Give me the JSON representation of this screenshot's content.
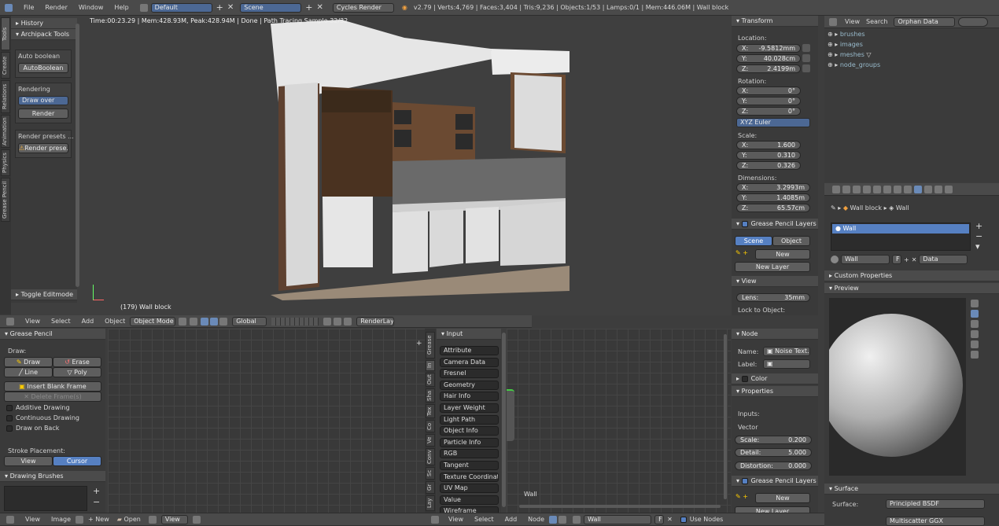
{
  "topbar": {
    "menus": [
      "File",
      "Render",
      "Window",
      "Help"
    ],
    "screen": "Default",
    "scene": "Scene",
    "engine": "Cycles Render",
    "stats": "v2.79 | Verts:4,769 | Faces:3,404 | Tris:9,236 | Objects:1/53 | Lamps:0/1 | Mem:446.06M | Wall block"
  },
  "viewport": {
    "render_info": "Time:00:23.29 | Mem:428.93M, Peak:428.94M | Done | Path Tracing Sample 32/32",
    "object_label": "(179) Wall block"
  },
  "vtabs": [
    "Tools",
    "Create",
    "Relations",
    "Animation",
    "Physics",
    "Grease Pencil"
  ],
  "tools": {
    "history": "History",
    "archipack": "Archipack Tools",
    "auto_boolean": "Auto boolean",
    "autoboolean_btn": "AutoBoolean",
    "rendering": "Rendering",
    "draw_over": "Draw over",
    "render_btn": "Render",
    "presets": "Render presets ...",
    "presets_btn": "Render prese...",
    "toggle_edit": "Toggle Editmode"
  },
  "transform": {
    "title": "Transform",
    "location": "Location:",
    "loc": [
      [
        "X:",
        "-9.5812mm"
      ],
      [
        "Y:",
        "40.028cm"
      ],
      [
        "Z:",
        "2.4199m"
      ]
    ],
    "rotation": "Rotation:",
    "rot": [
      [
        "X:",
        "0°"
      ],
      [
        "Y:",
        "0°"
      ],
      [
        "Z:",
        "0°"
      ]
    ],
    "euler": "XYZ Euler",
    "scale": "Scale:",
    "scl": [
      [
        "X:",
        "1.600"
      ],
      [
        "Y:",
        "0.310"
      ],
      [
        "Z:",
        "0.326"
      ]
    ],
    "dimensions": "Dimensions:",
    "dim": [
      [
        "X:",
        "3.2993m"
      ],
      [
        "Y:",
        "1.4085m"
      ],
      [
        "Z:",
        "65.57cm"
      ]
    ],
    "gp_layers": "Grease Pencil Layers",
    "scene": "Scene",
    "object": "Object",
    "new": "New",
    "new_layer": "New Layer",
    "view": "View",
    "lens_label": "Lens:",
    "lens_val": "35mm",
    "lock": "Lock to Object:"
  },
  "outliner": {
    "view": "View",
    "search": "Search",
    "mode": "Orphan Data",
    "items": [
      "brushes",
      "images",
      "meshes",
      "node_groups"
    ]
  },
  "properties": {
    "path1": "Wall block",
    "path2": "Wall",
    "slot": "Wall",
    "mat_name": "Wall",
    "data": "Data",
    "custom": "Custom Properties",
    "preview": "Preview",
    "surface": "Surface",
    "surface_label": "Surface:",
    "surface_val": "Principled BSDF",
    "dist": "Multiscatter GGX"
  },
  "v3dheader": {
    "items": [
      "View",
      "Select",
      "Add",
      "Object"
    ],
    "mode": "Object Mode",
    "orient": "Global",
    "layer": "RenderLayer"
  },
  "gpencil": {
    "title": "Grease Pencil",
    "draw": "Draw:",
    "draw_btn": "Draw",
    "erase": "Erase",
    "line": "Line",
    "poly": "Poly",
    "insert": "Insert Blank Frame",
    "delete": "Delete Frame(s)",
    "additive": "Additive Drawing",
    "continuous": "Continuous Drawing",
    "back": "Draw on Back",
    "stroke": "Stroke Placement:",
    "view": "View",
    "cursor": "Cursor",
    "brushes": "Drawing Brushes"
  },
  "nodes": {
    "input": "Input",
    "list": [
      "Attribute",
      "Camera Data",
      "Fresnel",
      "Geometry",
      "Hair Info",
      "Layer Weight",
      "Light Path",
      "Object Info",
      "Particle Info",
      "RGB",
      "Tangent",
      "Texture Coordinate",
      "UV Map",
      "Value",
      "Wireframe"
    ],
    "tabs": [
      "Grease",
      "In",
      "Out",
      "Sha",
      "Tex",
      "Co",
      "Ve",
      "Conv",
      "Sc",
      "Gr",
      "Lay"
    ],
    "canvas_label": "Wall"
  },
  "nodeprops": {
    "title": "Node",
    "name": "Name:",
    "name_val": "Noise Text...",
    "label": "Label:",
    "color": "Color",
    "properties": "Properties",
    "inputs": "Inputs:",
    "vector": "Vector",
    "scale": [
      "Scale:",
      "0.200"
    ],
    "detail": [
      "Detail:",
      "5.000"
    ],
    "distortion": [
      "Distortion:",
      "0.000"
    ],
    "gp": "Grease Pencil Layers",
    "new": "New",
    "new_layer": "New Layer"
  },
  "bottom": {
    "left": [
      "View",
      "Image"
    ],
    "new": "New",
    "open": "Open",
    "view": "View",
    "mid": [
      "View",
      "Select",
      "Add",
      "Node"
    ],
    "mat": "Wall",
    "use_nodes": "Use Nodes"
  }
}
